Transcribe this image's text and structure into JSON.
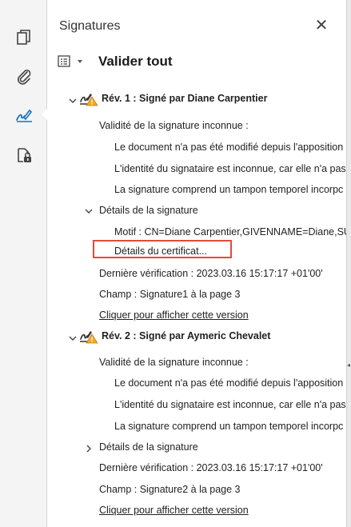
{
  "rail": {
    "icons": [
      "pages-icon",
      "attachment-icon",
      "signature-icon",
      "document-security-icon"
    ],
    "active": "signature-icon"
  },
  "panel": {
    "title": "Signatures",
    "validate_all": "Valider tout",
    "accent_color": "#e34a3f"
  },
  "revisions": [
    {
      "title": "Rév. 1 : Signé par Diane Carpentier",
      "validity": "Validité de la signature inconnue :",
      "details": [
        "Le document n'a pas été modifié depuis l'apposition",
        "L'identité du signataire est inconnue, car elle n'a pas",
        "La signature comprend un tampon temporel incorpc"
      ],
      "sig_details": "Détails de la signature",
      "reason": "Motif : CN=Diane Carpentier,GIVENNAME=Diane,SU",
      "cert_details": "Détails du certificat...",
      "last_check": "Dernière vérification : 2023.03.16 15:17:17 +01'00'",
      "field": "Champ : Signature1 à la page 3",
      "view_version": "Cliquer pour afficher cette version"
    },
    {
      "title": "Rév. 2 : Signé par Aymeric Chevalet",
      "validity": "Validité de la signature inconnue :",
      "details": [
        "Le document n'a pas été modifié depuis l'apposition",
        "L'identité du signataire est inconnue, car elle n'a pas",
        "La signature comprend un tampon temporel incorpc"
      ],
      "sig_details": "Détails de la signature",
      "last_check": "Dernière vérification : 2023.03.16 15:17:17 +01'00'",
      "field": "Champ : Signature2 à la page 3",
      "view_version": "Cliquer pour afficher cette version"
    }
  ]
}
